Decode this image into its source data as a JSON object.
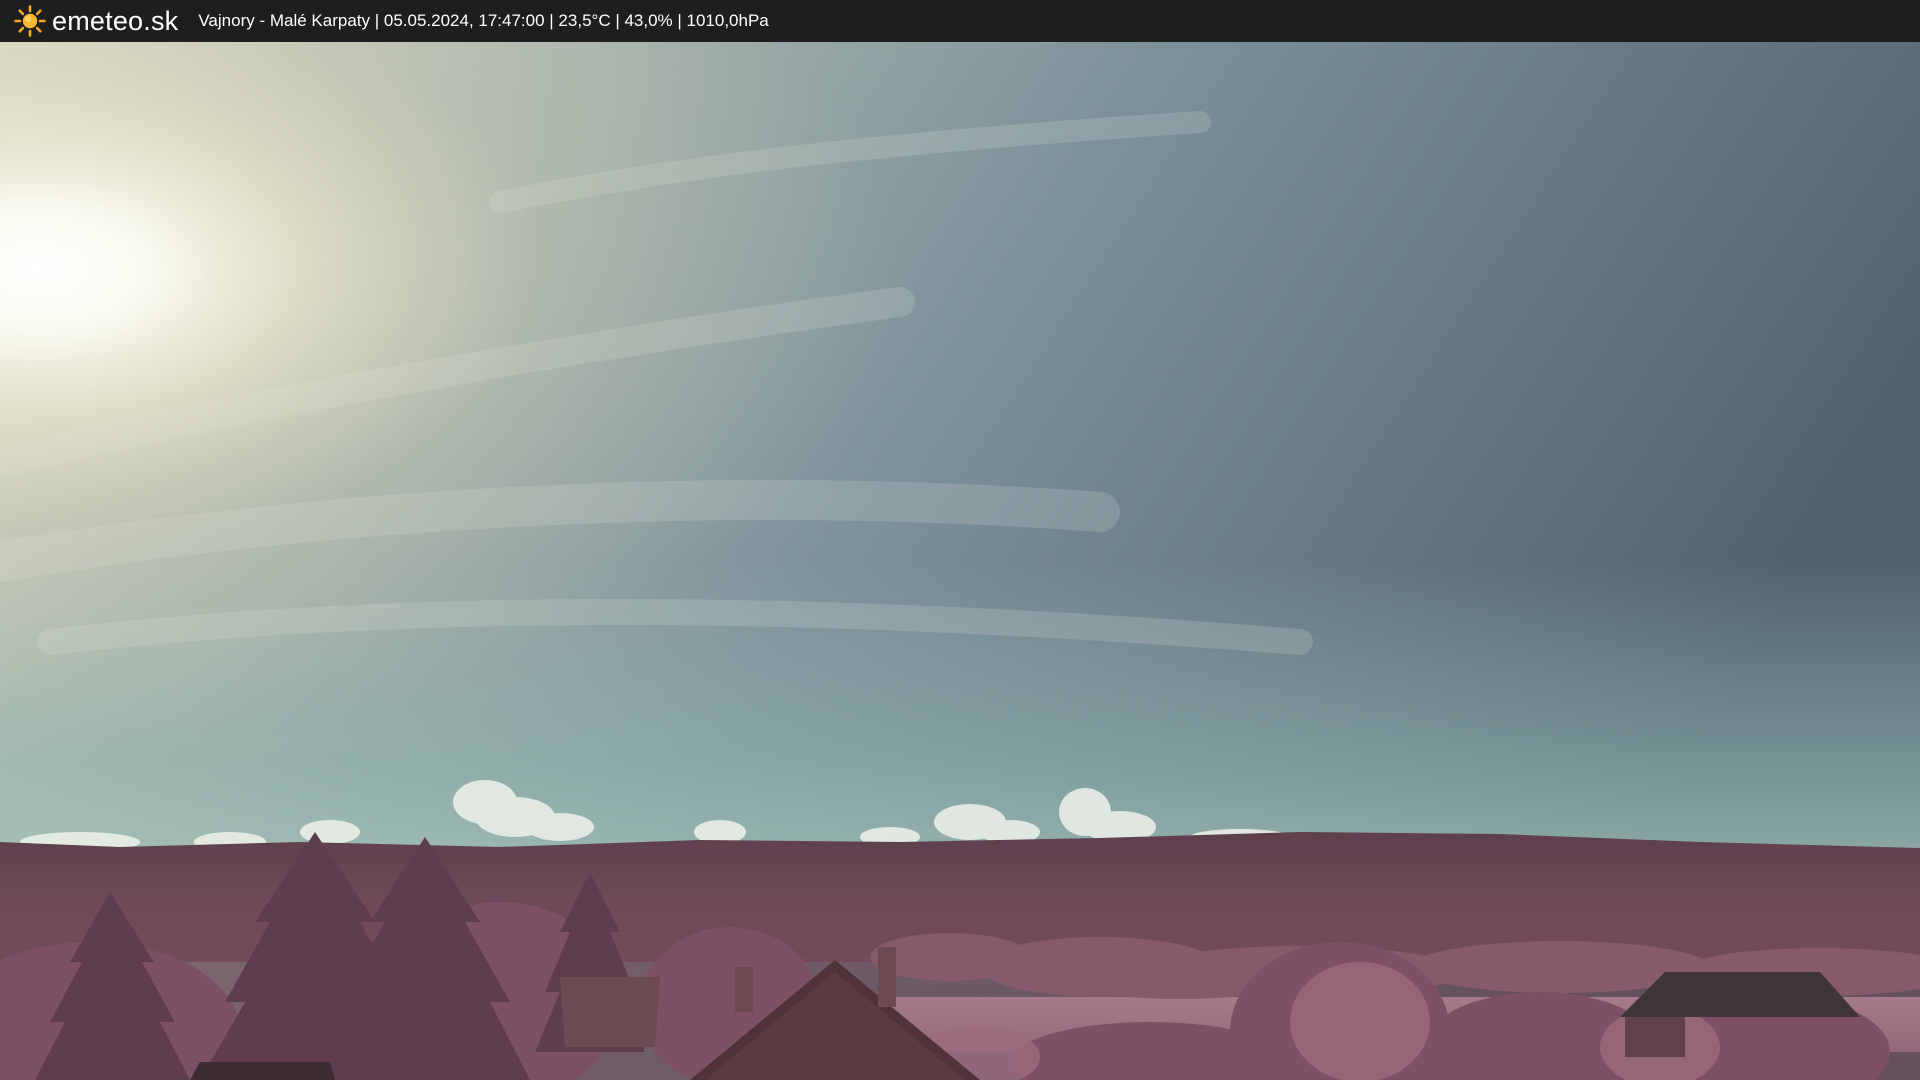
{
  "topbar": {
    "brand": "emeteo.sk",
    "brand_icon": "sun-icon",
    "caption": "Vajnory - Malé Karpaty | 05.05.2024, 17:47:00 | 23,5°C | 43,0% | 1010,0hPa"
  },
  "colors": {
    "bar_background": "#1e1e1e",
    "bar_text": "#ffffff",
    "sun_icon": "#f5a623",
    "sky_top": "#586b78",
    "sky_low": "#8fb3ad",
    "hills": "#6b4654",
    "foliage": "#8a5a6c"
  }
}
